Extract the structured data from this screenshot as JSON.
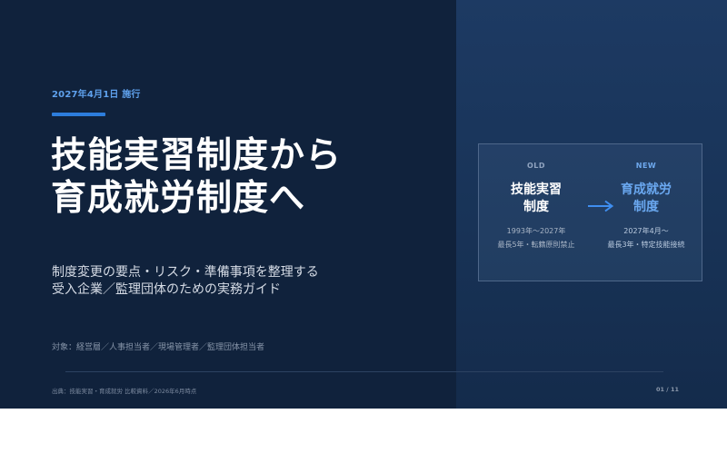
{
  "slide": {
    "date_label": "2027年4月1日 施行",
    "title_lines": [
      "技能実習制度から",
      "育成就労制度へ"
    ],
    "subtitle_lines": [
      "制度変更の要点・リスク・準備事項を整理する",
      "受入企業／監理団体のための実務ガイド"
    ],
    "audience": "対象：経営層／人事担当者／現場管理者／監理団体担当者",
    "footer_source": "出典：技能実習・育成就労 比較資料／2026年6月時点",
    "page_number": "01 / 11"
  },
  "comparison": {
    "old": {
      "tag": "OLD",
      "name_lines": [
        "技能実習",
        "制度"
      ],
      "period": "1993年〜2027年",
      "rule": "最長5年・転籍原則禁止"
    },
    "arrow_icon": "arrow-right-icon",
    "new": {
      "tag": "NEW",
      "name_lines": [
        "育成就労",
        "制度"
      ],
      "period": "2027年4月〜",
      "rule": "最長3年・特定技能接続"
    }
  },
  "colors": {
    "background": "#10223c",
    "right_panel": "#1b365b",
    "accent": "#2d7ddc",
    "new_highlight": "#6aa8f0"
  }
}
